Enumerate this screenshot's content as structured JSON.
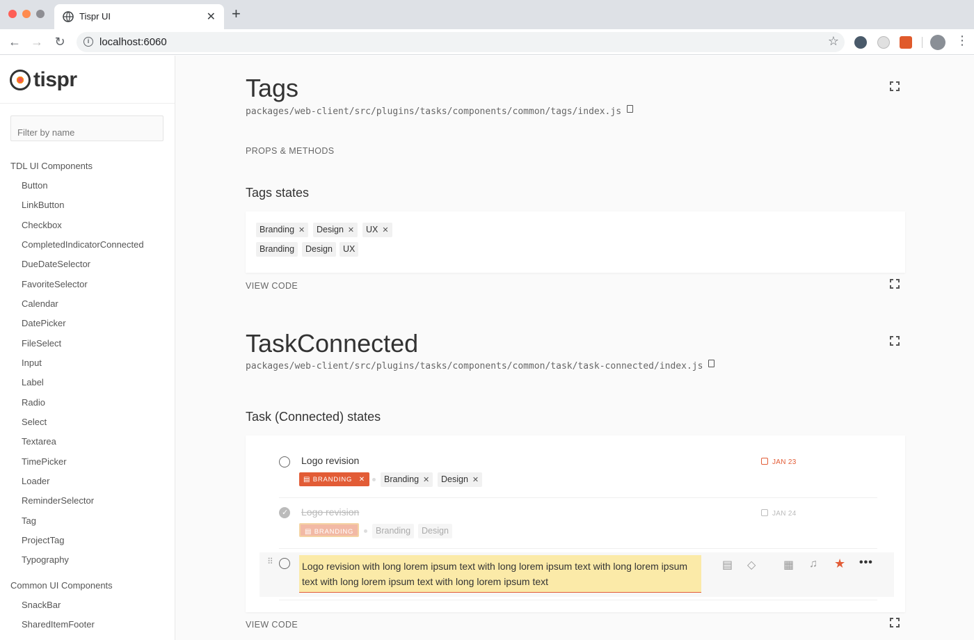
{
  "browser": {
    "tab_title": "Tispr UI",
    "url": "localhost:6060"
  },
  "sidebar": {
    "logo": "tispr",
    "filter_placeholder": "Filter by name",
    "groups": [
      {
        "label": "TDL UI Components",
        "items": [
          "Button",
          "LinkButton",
          "Checkbox",
          "CompletedIndicatorConnected",
          "DueDateSelector",
          "FavoriteSelector",
          "Calendar",
          "DatePicker",
          "FileSelect",
          "Input",
          "Label",
          "Radio",
          "Select",
          "Textarea",
          "TimePicker",
          "Loader",
          "ReminderSelector",
          "Tag",
          "ProjectTag",
          "Typography"
        ]
      },
      {
        "label": "Common UI Components",
        "items": [
          "SnackBar",
          "SharedItemFooter"
        ]
      }
    ]
  },
  "sections": {
    "tags": {
      "title": "Tags",
      "path": "packages/web-client/src/plugins/tasks/components/common/tags/index.js",
      "props_label": "PROPS & METHODS",
      "states_title": "Tags states",
      "row1": [
        "Branding",
        "Design",
        "UX"
      ],
      "row2": [
        "Branding",
        "Design",
        "UX"
      ],
      "view_code": "VIEW CODE"
    },
    "task": {
      "title": "TaskConnected",
      "path": "packages/web-client/src/plugins/tasks/components/common/task/task-connected/index.js",
      "states_title": "Task (Connected) states",
      "view_code": "VIEW CODE",
      "tasks": [
        {
          "title": "Logo revision",
          "project": "BRANDING",
          "tags": [
            "Branding",
            "Design"
          ],
          "due": "JAN 23",
          "completed": false
        },
        {
          "title": "Logo revision",
          "project": "BRANDING",
          "tags": [
            "Branding",
            "Design"
          ],
          "due": "JAN 24",
          "completed": true
        },
        {
          "title": "Logo revision with long lorem ipsum text with long lorem ipsum text with long lorem ipsum text with long lorem ipsum text with long lorem ipsum text",
          "favorite": true
        }
      ]
    }
  },
  "colors": {
    "accent": "#e25c36",
    "edit_highlight": "#fbeaa8"
  }
}
